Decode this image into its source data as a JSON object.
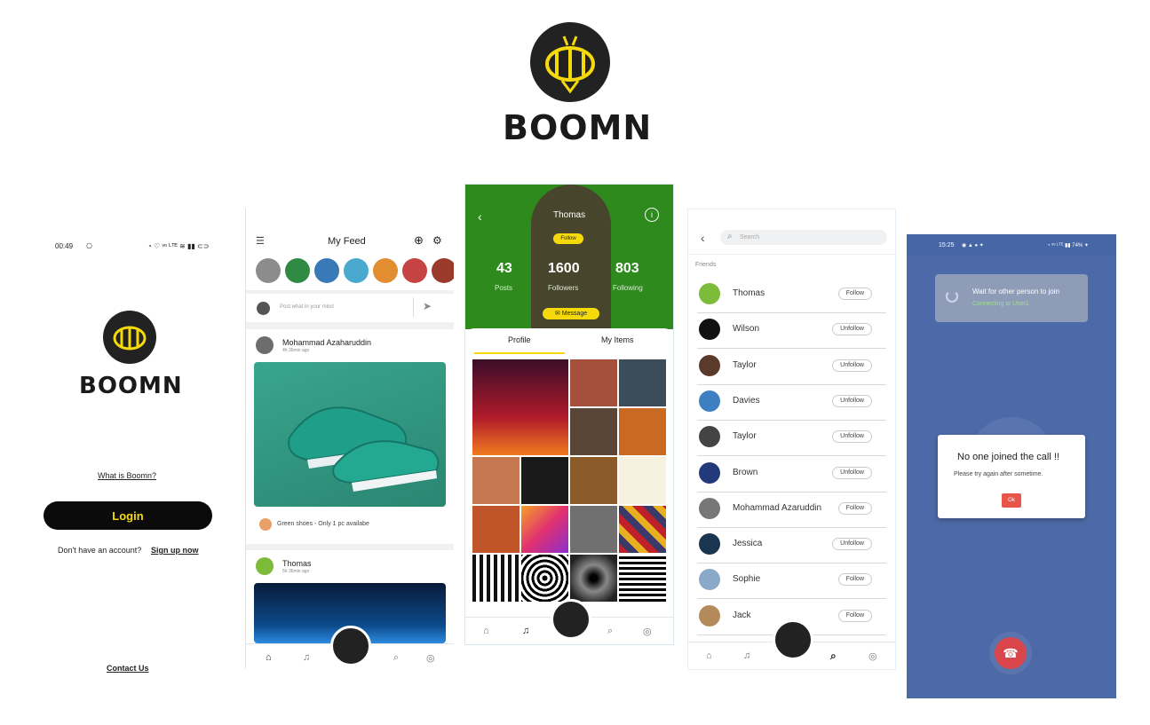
{
  "brand": {
    "name": "BOOMN",
    "accent": "#f5d90a",
    "dark": "#1c1c1c"
  },
  "login_screen": {
    "status_time": "00:49",
    "status_icons": "⎔",
    "status_right": "◔ ♡ ᵛᵒ ᴸᵀᴱ ≋ ▮▮ ⊂⊃",
    "what_is": "What is Boomn?",
    "login_label": "Login",
    "no_account": "Don't have an account?",
    "signup": "Sign up now",
    "contact": "Contact Us"
  },
  "feed_screen": {
    "title": "My Feed",
    "post_placeholder": "Post what in your mind",
    "post1": {
      "author": "Mohammad Azaharuddin",
      "time": "4h 36min ago",
      "caption": "Green shoes - Only 1 pc availabe"
    },
    "post2": {
      "author": "Thomas",
      "time": "5h 36min ago"
    },
    "story_colors": [
      "#8c8c8c",
      "#2f8a43",
      "#3a79b8",
      "#4aa9cf",
      "#e28d2f",
      "#c64343",
      "#9a3a2a"
    ]
  },
  "profile_screen": {
    "name": "Thomas",
    "follow": "Follow",
    "posts_count": "43",
    "posts_label": "Posts",
    "followers_count": "1600",
    "followers_label": "Followers",
    "following_count": "803",
    "following_label": "Following",
    "message": "Message",
    "tabs": [
      "Profile",
      "My Items"
    ]
  },
  "friends_screen": {
    "search_placeholder": "Search",
    "section": "Friends",
    "friends": [
      {
        "name": "Thomas",
        "action": "Follow",
        "color": "#7dbb3a"
      },
      {
        "name": "Wilson",
        "action": "Unfollow",
        "color": "#111111"
      },
      {
        "name": "Taylor",
        "action": "Unfollow",
        "color": "#5a3a2a"
      },
      {
        "name": "Davies",
        "action": "Unfollow",
        "color": "#3d7fc0"
      },
      {
        "name": "Taylor",
        "action": "Unfollow",
        "color": "#444444"
      },
      {
        "name": "Brown",
        "action": "Unfollow",
        "color": "#233a7a"
      },
      {
        "name": "Mohammad Azaruddin",
        "action": "Follow",
        "color": "#777777"
      },
      {
        "name": "Jessica",
        "action": "Unfollow",
        "color": "#1a3550"
      },
      {
        "name": "Sophie",
        "action": "Follow",
        "color": "#8aa9c9"
      },
      {
        "name": "Jack",
        "action": "Follow",
        "color": "#b58a5a"
      }
    ]
  },
  "call_screen": {
    "status_time": "15:25",
    "status_icons": "◉ ▲ ● ✦",
    "status_right": "◔ ᵛᵒ ᴸᵀᴱ ▮▮ 74% ✦",
    "waiting": "Wait for other person to join",
    "connecting": "Connecting to User1",
    "dialog_title": "No one joined the call !!",
    "dialog_msg": "Please try again after sometime.",
    "ok": "Ok"
  },
  "nav_icons": [
    "home-icon",
    "bell-icon",
    "search-icon",
    "profile-icon"
  ]
}
